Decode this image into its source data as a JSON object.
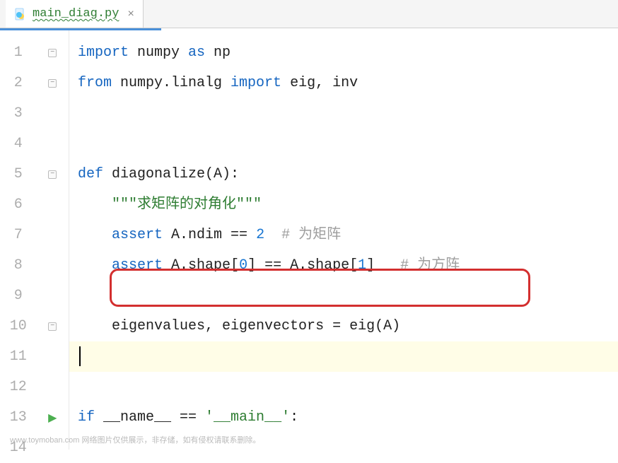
{
  "tab": {
    "filename": "main_diag.py",
    "close_label": "×"
  },
  "gutter": {
    "lines": [
      "1",
      "2",
      "3",
      "4",
      "5",
      "6",
      "7",
      "8",
      "9",
      "10",
      "11",
      "12",
      "13",
      "14"
    ]
  },
  "code": {
    "l1": {
      "kw1": "import",
      "t1": " numpy ",
      "kw2": "as",
      "t2": " np"
    },
    "l2": {
      "kw1": "from",
      "t1": " numpy.linalg ",
      "kw2": "import",
      "t2": " eig, inv"
    },
    "l5": {
      "kw1": "def",
      "t1": " diagonalize(A):"
    },
    "l6": {
      "indent": "    ",
      "str": "\"\"\"求矩阵的对角化\"\"\""
    },
    "l7": {
      "indent": "    ",
      "kw": "assert",
      "t1": " A.ndim == ",
      "num": "2",
      "pad": "  ",
      "comment": "# 为矩阵"
    },
    "l8": {
      "indent": "    ",
      "kw": "assert",
      "t1": " A.shape[",
      "n1": "0",
      "t2": "] == A.shape[",
      "n2": "1",
      "t3": "]   ",
      "comment": "# 为方阵"
    },
    "l10": {
      "indent": "    ",
      "t": "eigenvalues, eigenvectors = eig(A)"
    },
    "l13": {
      "kw": "if",
      "t1": " __name__ == ",
      "str": "'__main__'",
      "t2": ":"
    }
  },
  "watermark": "www.toymoban.com 网络图片仅供展示，非存储，如有侵权请联系删除。"
}
